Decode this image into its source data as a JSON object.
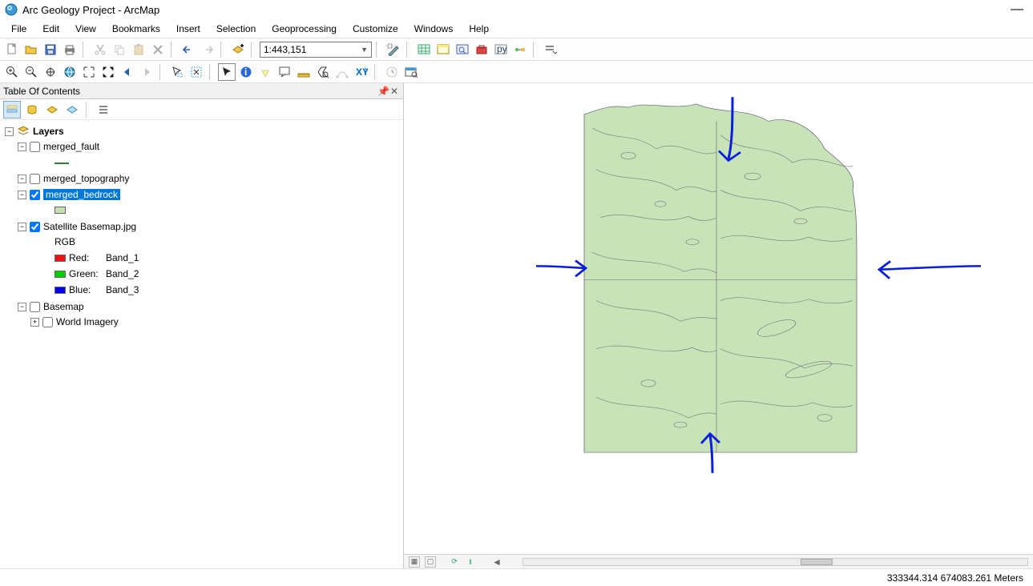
{
  "window": {
    "title": "Arc Geology Project - ArcMap",
    "minimize": "—"
  },
  "menubar": [
    "File",
    "Edit",
    "View",
    "Bookmarks",
    "Insert",
    "Selection",
    "Geoprocessing",
    "Customize",
    "Windows",
    "Help"
  ],
  "toolbar": {
    "scale": "1:443,151"
  },
  "toc": {
    "title": "Table Of Contents",
    "root": {
      "label": "Layers",
      "items": [
        {
          "label": "merged_fault",
          "checked": false,
          "type": "line",
          "selected": false
        },
        {
          "label": "merged_topography",
          "checked": false,
          "type": "none",
          "selected": false
        },
        {
          "label": "merged_bedrock",
          "checked": true,
          "type": "poly",
          "selected": true,
          "swatch": "#c4e0b3"
        },
        {
          "label": "Satellite Basemap.jpg",
          "checked": true,
          "type": "raster",
          "selected": false,
          "rgb_label": "RGB",
          "bands": [
            {
              "color": "#e11",
              "label": "Red:",
              "band": "Band_1"
            },
            {
              "color": "#0c0",
              "label": "Green:",
              "band": "Band_2"
            },
            {
              "color": "#00e",
              "label": "Blue:",
              "band": "Band_3"
            }
          ]
        },
        {
          "label": "Basemap",
          "checked": false,
          "type": "group",
          "selected": false,
          "children": [
            {
              "label": "World Imagery",
              "checked": false
            }
          ]
        }
      ]
    }
  },
  "statusbar": {
    "coords": "333344.314  674083.261 Meters"
  }
}
